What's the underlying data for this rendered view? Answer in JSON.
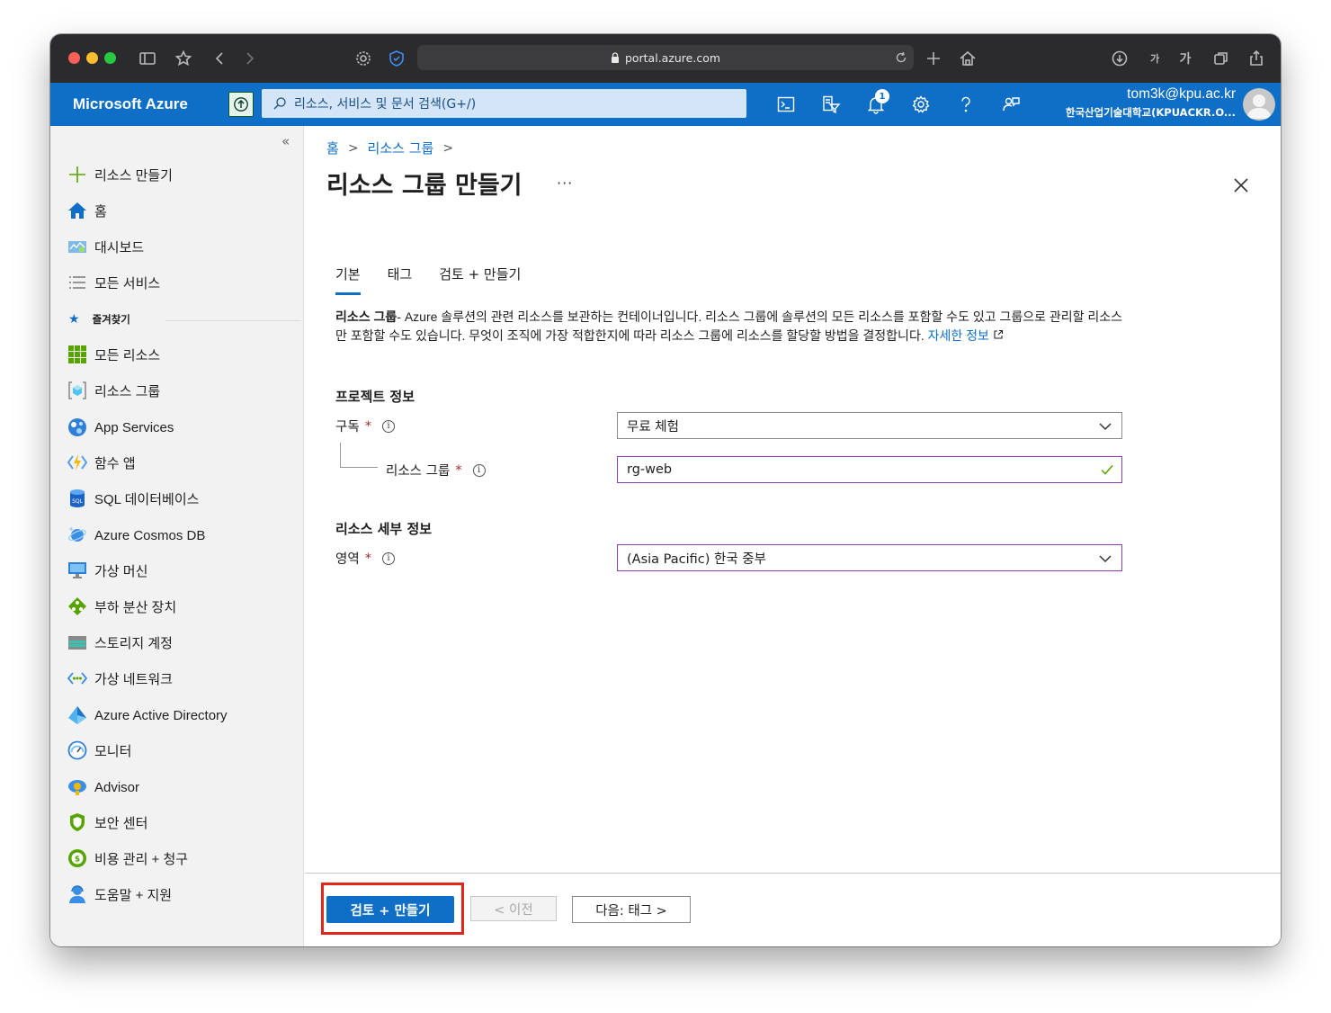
{
  "browser": {
    "url": "portal.azure.com",
    "text_size_small": "가",
    "text_size_large": "가"
  },
  "header": {
    "brand": "Microsoft Azure",
    "search_placeholder": "리소스, 서비스 및 문서 검색(G+/)",
    "notification_count": "1",
    "account_email": "tom3k@kpu.ac.kr",
    "account_tenant": "한국산업기술대학교(KPUACKR.O..."
  },
  "sidebar": {
    "collapse": "«",
    "create_resource": "리소스 만들기",
    "home": "홈",
    "dashboard": "대시보드",
    "all_services": "모든 서비스",
    "favorites_label": "즐겨찾기",
    "favorites": [
      {
        "label": "모든 리소스",
        "icon": "grid-icon"
      },
      {
        "label": "리소스 그룹",
        "icon": "resource-group-icon"
      },
      {
        "label": "App Services",
        "icon": "app-services-icon"
      },
      {
        "label": "함수 앱",
        "icon": "function-app-icon"
      },
      {
        "label": "SQL 데이터베이스",
        "icon": "sql-icon"
      },
      {
        "label": "Azure Cosmos DB",
        "icon": "cosmos-db-icon"
      },
      {
        "label": "가상 머신",
        "icon": "virtual-machine-icon"
      },
      {
        "label": "부하 분산 장치",
        "icon": "load-balancer-icon"
      },
      {
        "label": "스토리지 계정",
        "icon": "storage-icon"
      },
      {
        "label": "가상 네트워크",
        "icon": "virtual-network-icon"
      },
      {
        "label": "Azure Active Directory",
        "icon": "active-directory-icon"
      },
      {
        "label": "모니터",
        "icon": "monitor-icon"
      },
      {
        "label": "Advisor",
        "icon": "advisor-icon"
      },
      {
        "label": "보안 센터",
        "icon": "security-center-icon"
      },
      {
        "label": "비용 관리 + 청구",
        "icon": "cost-management-icon"
      },
      {
        "label": "도움말 + 지원",
        "icon": "help-support-icon"
      }
    ]
  },
  "main": {
    "breadcrumb": [
      "홈",
      "리소스 그룹"
    ],
    "title": "리소스 그룹 만들기",
    "more": "···",
    "tabs": [
      "기본",
      "태그",
      "검토 + 만들기"
    ],
    "description_bold": "리소스 그룹",
    "description_text": "- Azure 솔루션의 관련 리소스를 보관하는 컨테이너입니다. 리소스 그룹에 솔루션의 모든 리소스를 포함할 수도 있고 그룹으로 관리할 리소스만 포함할 수도 있습니다. 무엇이 조직에 가장 적합한지에 따라 리소스 그룹에 리소스를 할당할 방법을 결정합니다. ",
    "description_link": "자세한 정보",
    "project_section": "프로젝트 정보",
    "subscription_label": "구독",
    "subscription_value": "무료 체험",
    "resource_group_label": "리소스 그룹",
    "resource_group_value": "rg-web",
    "details_section": "리소스 세부 정보",
    "region_label": "영역",
    "region_value": "(Asia Pacific) 한국 중부",
    "required_mark": "*",
    "info_mark": "i"
  },
  "footer": {
    "review_create": "검토 + 만들기",
    "previous": "< 이전",
    "next": "다음: 태그 >"
  },
  "colors": {
    "azure_blue": "#0f6fc6",
    "required_red": "#a4262c",
    "highlight_red": "#e0261e",
    "valid_purple": "#8a3fa8"
  }
}
